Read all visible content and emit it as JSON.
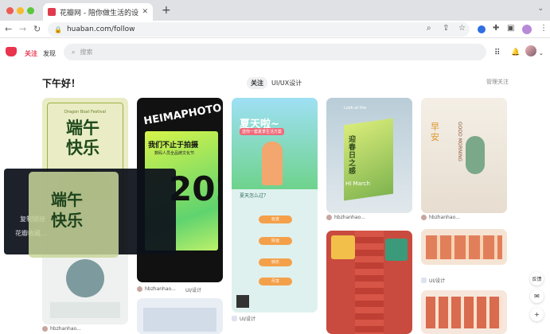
{
  "browser": {
    "tab_title": "花瓣网 - 陪你做生活的设计师（发现...",
    "tab_close": "✕",
    "new_tab": "+",
    "url": "huaban.com/follow"
  },
  "app": {
    "nav_follow": "关注",
    "nav_discover": "发现",
    "search_placeholder": "搜索"
  },
  "feed": {
    "greeting": "下午好！",
    "tabs": [
      "关注",
      "UI/UX设计"
    ],
    "edit_label": "管理关注"
  },
  "cards": [
    {
      "lines": [
        "Dragon Boat Festival",
        "端午",
        "快乐"
      ]
    },
    {
      "lines": [
        "HEIMAPHOTO",
        "我们不止于拍摄",
        "数码人员全品牌文化节",
        "2022"
      ]
    },
    {
      "lines": [
        "夏天啦~",
        "送你一套夏季生活方案",
        "夏天怎么过？",
        "玩去",
        "好运",
        "快乐",
        "尽享"
      ]
    },
    {
      "lines": [
        "迎春日之感",
        "HI March",
        "Look at the",
        "Looking"
      ]
    },
    {
      "lines": [
        "早安",
        "GOOD MORNING"
      ]
    }
  ],
  "card_meta": [
    {
      "user": "hbzhanhao...",
      "board": "UI/设计"
    },
    {
      "user": "hbzhanhao...",
      "board": "UI/设计"
    },
    {
      "user": "hbzhanhao...",
      "board": "UI/设计"
    },
    {
      "user": "hbzhanhao...",
      "board": "UI/设计"
    },
    {
      "user": "hbzhanhao...",
      "board": "UI/设计"
    }
  ],
  "side_actions": [
    "反馈",
    "✉",
    "+"
  ],
  "overlay": {
    "line1": "复制链接",
    "line2": "花瓣收藏..."
  },
  "colors": {
    "brand": "#e8344c",
    "overlay_bg": "#0c101a"
  },
  "icons": [
    "search-icon",
    "lock-icon",
    "bell-icon",
    "grid-icon",
    "share-icon",
    "star-icon",
    "bookmark-icon",
    "extension-icon",
    "mail-icon",
    "plus-icon"
  ]
}
